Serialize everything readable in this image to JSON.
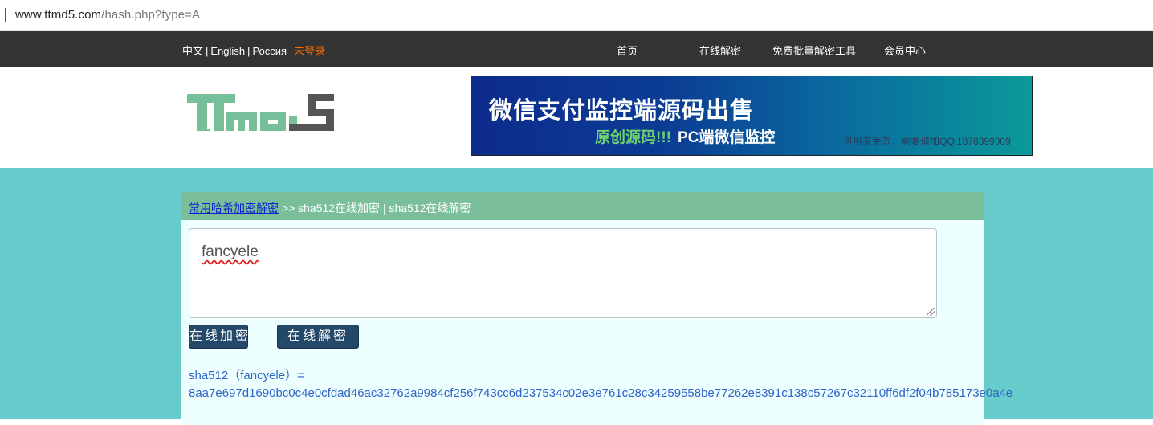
{
  "browser": {
    "url_host": "www.ttmd5.com",
    "url_path": "/hash.php?type=A"
  },
  "topnav": {
    "lang_zh": "中文",
    "lang_en": "English",
    "lang_ru": "Россия",
    "separator": "|",
    "login": "未登录",
    "links": [
      "首页",
      "在线解密",
      "免费批量解密工具",
      "会员中心"
    ],
    "login_color": "#ff6a00",
    "bg_color": "#333333"
  },
  "header": {
    "logo_alt": "TTmd5",
    "banner": {
      "headline": "微信支付监控端源码出售",
      "sub_green": "原创源码!!!",
      "sub_white": "PC端微信监控",
      "note": "可用来免签，需要请加QQ:1878399009"
    }
  },
  "main": {
    "breadcrumb_link": "常用哈希加密解密",
    "breadcrumb_rest": " >> sha512在线加密 | sha512在线解密",
    "input_value": "fancyele",
    "encrypt_button": "在线加密",
    "decrypt_button": "在线解密",
    "result_label": "sha512（fancyele）=",
    "result_hash": "8aa7e697d1690bc0c4e0cfdad46ac32762a9984cf256f743cc6d237534c02e3e761c28c34259558be77262e8391c138c57267c32110ff6df2f04b785173e0a4e",
    "bg_color": "#66cccc",
    "panel_color": "#eeffff",
    "header_color": "#7abf9a",
    "button_color": "#24486a"
  }
}
